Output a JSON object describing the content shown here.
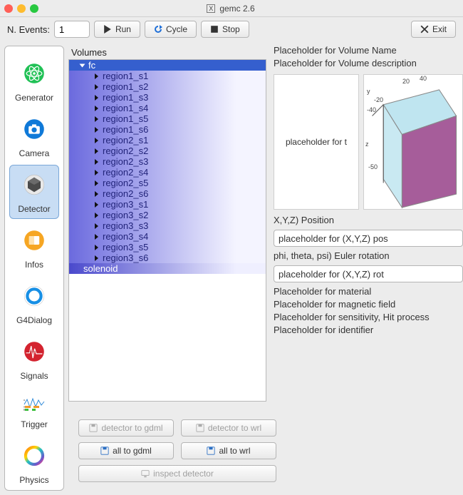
{
  "title": "gemc 2.6",
  "toolbar": {
    "nevents_label": "N. Events:",
    "nevents_value": "1",
    "run": "Run",
    "cycle": "Cycle",
    "stop": "Stop",
    "exit": "Exit"
  },
  "sidebar": {
    "items": [
      {
        "id": "generator",
        "label": "Generator"
      },
      {
        "id": "camera",
        "label": "Camera"
      },
      {
        "id": "detector",
        "label": "Detector"
      },
      {
        "id": "infos",
        "label": "Infos"
      },
      {
        "id": "g4dialog",
        "label": "G4Dialog"
      },
      {
        "id": "signals",
        "label": "Signals"
      },
      {
        "id": "trigger",
        "label": "Trigger"
      },
      {
        "id": "physics",
        "label": "Physics"
      }
    ],
    "selected": "detector"
  },
  "tree": {
    "header": "Volumes",
    "root": "fc",
    "regions": [
      "region1_s1",
      "region1_s2",
      "region1_s3",
      "region1_s4",
      "region1_s5",
      "region1_s6",
      "region2_s1",
      "region2_s2",
      "region2_s3",
      "region2_s4",
      "region2_s5",
      "region2_s6",
      "region3_s1",
      "region3_s2",
      "region3_s3",
      "region3_s4",
      "region3_s5",
      "region3_s6"
    ],
    "tail": "solenoid"
  },
  "detail": {
    "volname": "Placeholder for Volume Name",
    "voldesc": "Placeholder for Volume description",
    "vispanel": "placeholder for t",
    "pos_label": "X,Y,Z) Position",
    "pos_value": "placeholder for (X,Y,Z) pos",
    "rot_label": "phi, theta, psi) Euler rotation",
    "rot_value": "placeholder for (X,Y,Z) rot",
    "material": "Placeholder for material",
    "magfield": "Placeholder for magnetic field",
    "sensitivity": "Placeholder for sensitivity, Hit process",
    "identifier": "Placeholder for identifier",
    "axis_labels": {
      "y": "y",
      "z": "z",
      "t20": "20",
      "t40": "40",
      "m20": "-20",
      "m40": "-40",
      "m50": "-50"
    }
  },
  "buttons": {
    "det_gdml": "detector to gdml",
    "det_wrl": "detector to wrl",
    "all_gdml": "all to gdml",
    "all_wrl": "all to wrl",
    "inspect": "inspect detector"
  }
}
